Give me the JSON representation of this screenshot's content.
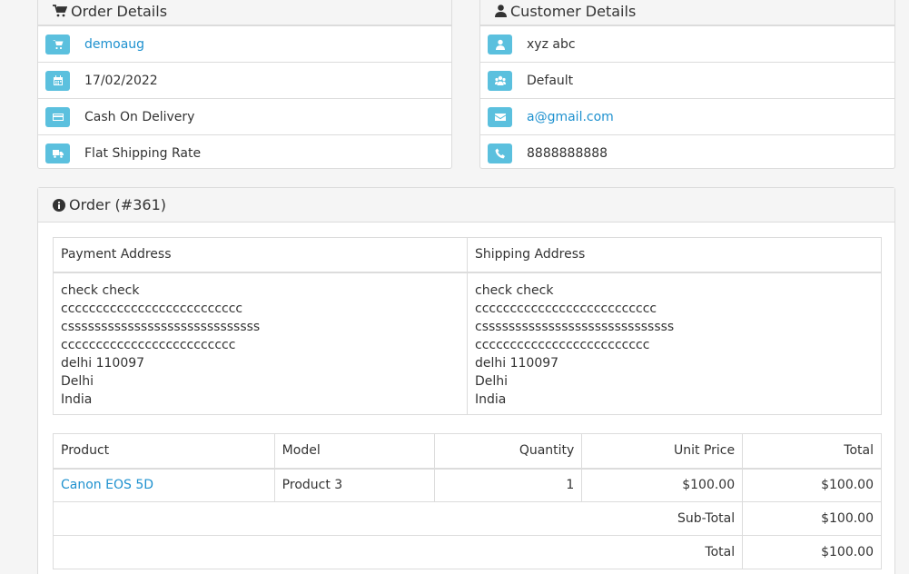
{
  "order_details": {
    "title": "Order Details",
    "store": "demoaug",
    "date": "17/02/2022",
    "payment_method": "Cash On Delivery",
    "shipping_method": "Flat Shipping Rate"
  },
  "customer_details": {
    "title": "Customer Details",
    "name": "xyz abc",
    "group": "Default",
    "email": "a@gmail.com",
    "phone": "8888888888"
  },
  "order": {
    "title": "Order (#361)",
    "payment_address_header": "Payment Address",
    "shipping_address_header": "Shipping Address",
    "payment_address": [
      "check check",
      "cccccccccccccccccccccccccc",
      "csssssssssssssssssssssssssssss",
      "ccccccccccccccccccccccccc",
      "delhi 110097",
      "Delhi",
      "India"
    ],
    "shipping_address": [
      "check check",
      "cccccccccccccccccccccccccc",
      "csssssssssssssssssssssssssssss",
      "ccccccccccccccccccccccccc",
      "delhi 110097",
      "Delhi",
      "India"
    ],
    "columns": {
      "product": "Product",
      "model": "Model",
      "quantity": "Quantity",
      "unit_price": "Unit Price",
      "total": "Total"
    },
    "items": [
      {
        "product": "Canon EOS 5D",
        "model": "Product 3",
        "quantity": "1",
        "unit_price": "$100.00",
        "total": "$100.00"
      }
    ],
    "totals": [
      {
        "label": "Sub-Total",
        "value": "$100.00"
      },
      {
        "label": "Total",
        "value": "$100.00"
      }
    ]
  },
  "colors": {
    "accent": "#1e91cf",
    "icon_button": "#5bc0de"
  }
}
